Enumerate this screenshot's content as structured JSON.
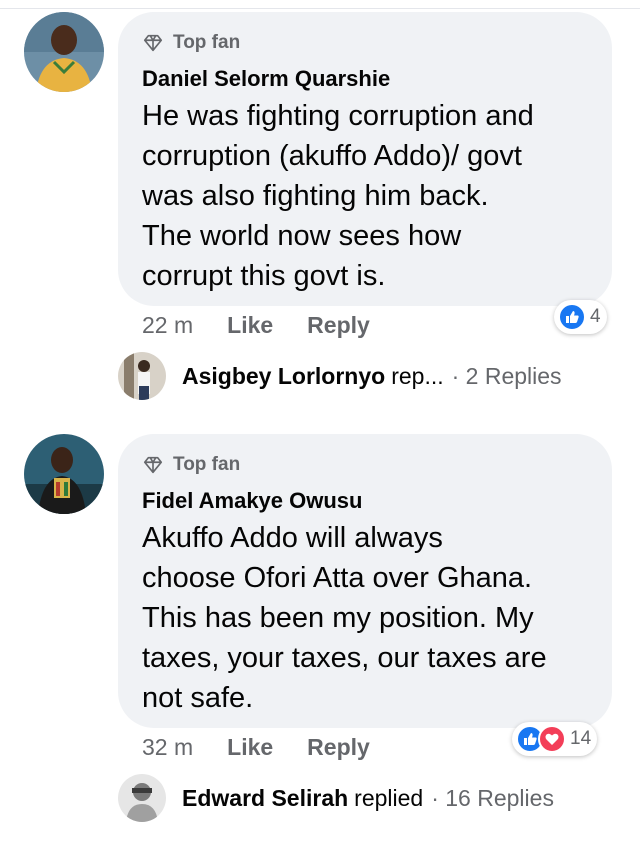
{
  "comments": [
    {
      "badge": "Top fan",
      "author": "Daniel Selorm Quarshie",
      "lines": [
        "He was fighting corruption and",
        "corruption (akuffo Addo)/ govt",
        "was also fighting him back.",
        "The world now sees how",
        "corrupt this govt is."
      ],
      "time": "22 m",
      "like_label": "Like",
      "reply_label": "Reply",
      "reaction_count": "4",
      "reply": {
        "name": "Asigbey Lorlornyo",
        "rest": "rep...",
        "count": "· 2 Replies"
      }
    },
    {
      "badge": "Top fan",
      "author": "Fidel Amakye Owusu",
      "lines": [
        "Akuffo Addo will always",
        "choose Ofori Atta over Ghana.",
        "This has been my position. My",
        "taxes, your taxes, our taxes are",
        "not safe."
      ],
      "time": "32 m",
      "like_label": "Like",
      "reply_label": "Reply",
      "reaction_count": "14",
      "reply": {
        "name": "Edward Selirah",
        "rest": "replied",
        "count": "· 16 Replies"
      }
    }
  ],
  "colors": {
    "like": "#1877f2",
    "love": "#f33e58",
    "bubble": "#f0f2f5",
    "muted": "#65676b"
  }
}
